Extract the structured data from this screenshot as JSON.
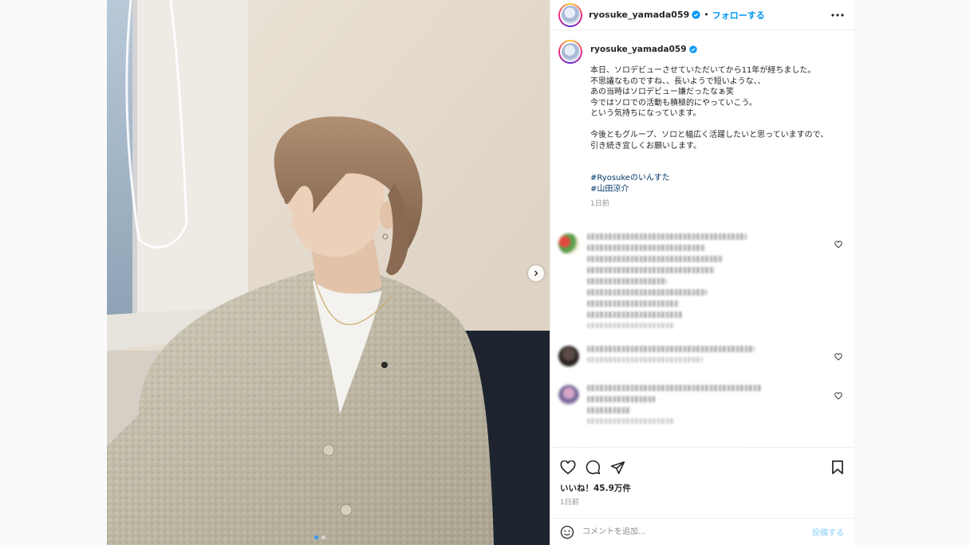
{
  "post": {
    "username": "ryosuke_yamada059",
    "separator": "•",
    "follow_label": "フォローする",
    "more_icon": "more-horizontal-icon",
    "verified_icon": "verified-badge-icon",
    "verified_color": "#0095f6",
    "next_icon": "chevron-right-icon",
    "carousel": {
      "total": 2,
      "active": 1
    }
  },
  "caption": {
    "username": "ryosuke_yamada059",
    "text": "本日、ソロデビューさせていただいてから11年が経ちました。\n不思議なものですね、、長いようで短いような、、\nあの当時はソロデビュー嫌だったなぁ笑\n今ではソロでの活動も積極的にやっていこう。\nという気持ちになっています。\n\n今後ともグループ、ソロと幅広く活躍したいと思っていますので、\n引き続き宜しくお願いします。",
    "hashtags": [
      "#Ryosukeのいんすた",
      "#山田涼介"
    ],
    "time": "1日前"
  },
  "comments_note": "comments are pixelated/obscured in the source",
  "actions": {
    "like_icon": "heart-icon",
    "comment_icon": "comment-icon",
    "share_icon": "share-icon",
    "save_icon": "bookmark-icon",
    "likes": "いいね！45.9万件",
    "date": "1日前"
  },
  "add_comment": {
    "emoji_icon": "emoji-icon",
    "placeholder": "コメントを追加...",
    "post_label": "投稿する"
  },
  "colors": {
    "link": "#00376b",
    "accent": "#0095f6",
    "muted": "#8e8e8e"
  }
}
